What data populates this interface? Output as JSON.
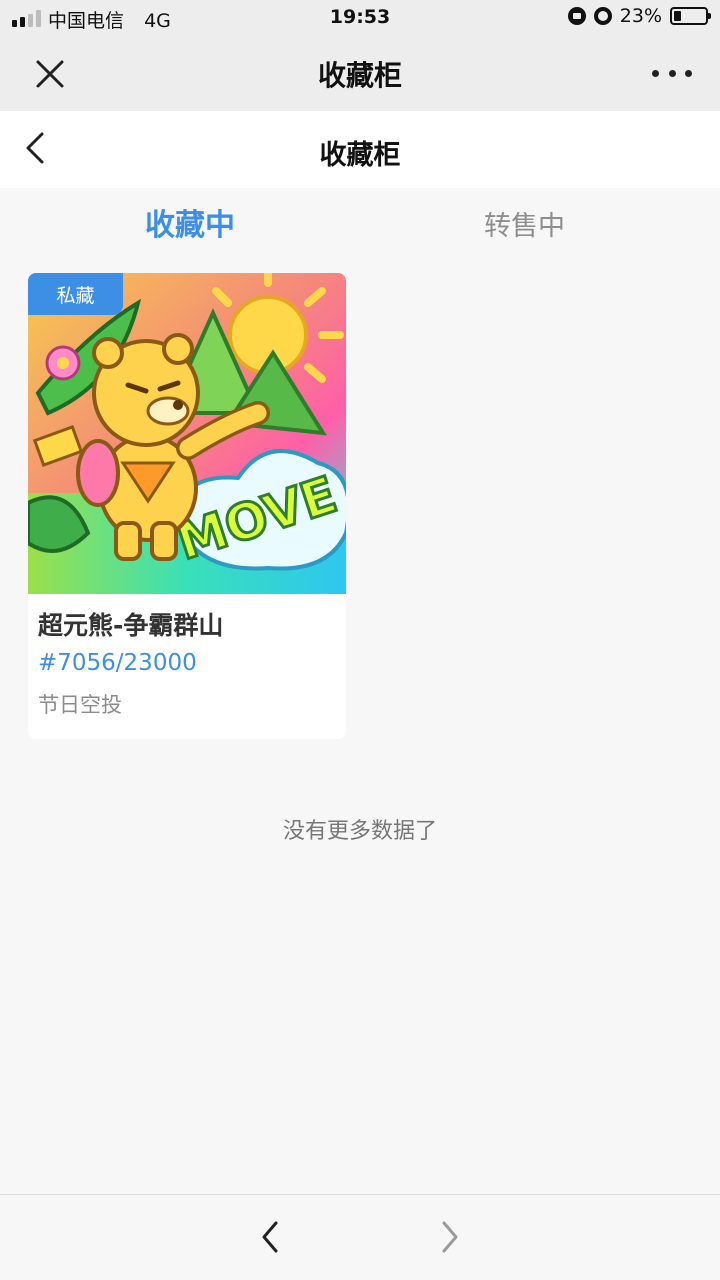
{
  "status_bar": {
    "carrier": "中国电信",
    "network": "4G",
    "time": "19:53",
    "battery": "23%",
    "battery_level": 0.23
  },
  "wechat_bar": {
    "title": "收藏柜",
    "close_icon": "close-icon",
    "more_icon": "more-dots-icon"
  },
  "header": {
    "title": "收藏柜",
    "back_icon": "chevron-left-icon"
  },
  "tabs": [
    {
      "label": "收藏中",
      "active": true
    },
    {
      "label": "转售中",
      "active": false
    }
  ],
  "items": [
    {
      "badge": "私藏",
      "name": "超元熊-争霸群山",
      "number": "#7056/23000",
      "source": "节日空投"
    }
  ],
  "list_end_text": "没有更多数据了",
  "bottom_nav": {
    "back_icon": "chevron-left-icon",
    "forward_icon": "chevron-right-icon"
  },
  "colors": {
    "accent": "#3d8fe6",
    "inactive_tab": "#8e8e8e",
    "background": "#f7f7f7"
  }
}
